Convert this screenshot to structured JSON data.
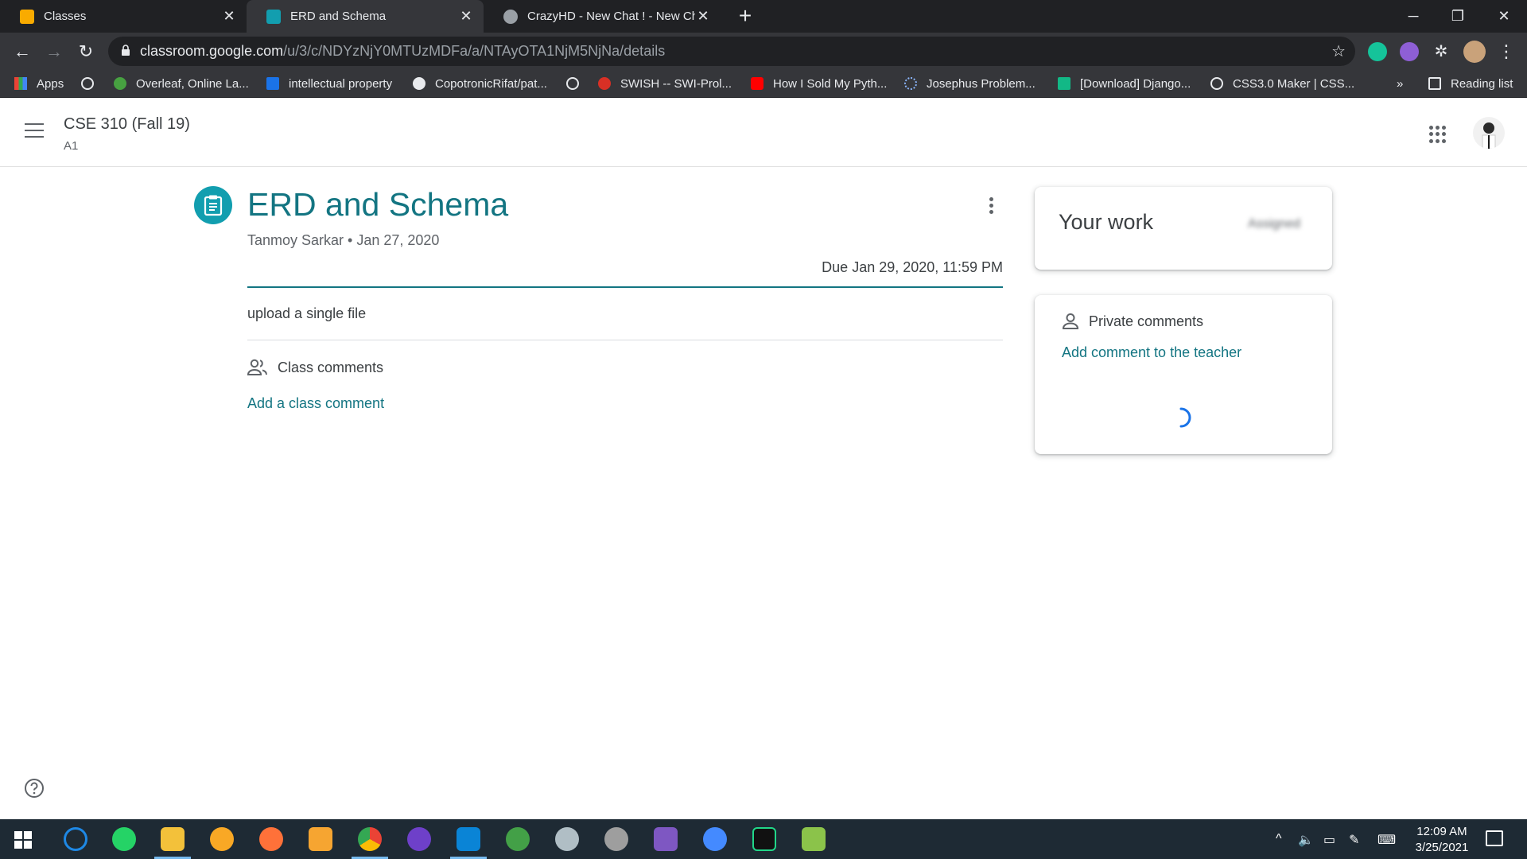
{
  "browser": {
    "tabs": [
      {
        "title": "Classes",
        "favicon_color": "#f9ab00"
      },
      {
        "title": "ERD and Schema",
        "favicon_color": "#129eaf",
        "active": true
      },
      {
        "title": "CrazyHD - New Chat ! - New Cha",
        "favicon_color": "#9aa0a6"
      }
    ],
    "url_host": "classroom.google.com",
    "url_path": "/u/3/c/NDYzNjY0MTUzMDFa/a/NTAyOTA1NjM5NjNa/details",
    "bookmarks": [
      {
        "label": "Apps",
        "icon": "apps-grid-icon",
        "color": "#ea4335"
      },
      {
        "label": "",
        "icon": "globe-icon",
        "color": "#e8eaed"
      },
      {
        "label": "Overleaf, Online La...",
        "icon": "overleaf-icon",
        "color": "#47a141"
      },
      {
        "label": "intellectual property",
        "icon": "bookmark-s-icon",
        "color": "#1a73e8"
      },
      {
        "label": "CopotronicRifat/pat...",
        "icon": "github-icon",
        "color": "#e8eaed"
      },
      {
        "label": "",
        "icon": "globe-icon",
        "color": "#e8eaed"
      },
      {
        "label": "SWISH -- SWI-Prol...",
        "icon": "swish-icon",
        "color": "#d93025"
      },
      {
        "label": "How I Sold My Pyth...",
        "icon": "youtube-icon",
        "color": "#ff0000"
      },
      {
        "label": "Josephus Problem...",
        "icon": "loading-dots-icon",
        "color": "#8ab4f8"
      },
      {
        "label": "[Download] Django...",
        "icon": "django-icon",
        "color": "#12b886"
      },
      {
        "label": "CSS3.0 Maker | CSS...",
        "icon": "globe-icon",
        "color": "#e8eaed"
      }
    ],
    "overflow_label": "»",
    "reading_list_label": "Reading list"
  },
  "header": {
    "class_name": "CSE 310 (Fall 19)",
    "section": "A1"
  },
  "assignment": {
    "title": "ERD and Schema",
    "meta": "Tanmoy Sarkar • Jan 27, 2020",
    "due": "Due Jan 29, 2020, 11:59 PM",
    "instructions": "upload a single file",
    "class_comments_label": "Class comments",
    "add_class_comment": "Add a class comment"
  },
  "your_work": {
    "title": "Your work",
    "status": "Assigned"
  },
  "private_comments": {
    "label": "Private comments",
    "add_link": "Add comment to the teacher"
  },
  "taskbar": {
    "time": "12:09 AM",
    "date": "3/25/2021"
  },
  "colors": {
    "accent": "#137582",
    "assignment_icon_bg": "#129eaf"
  }
}
